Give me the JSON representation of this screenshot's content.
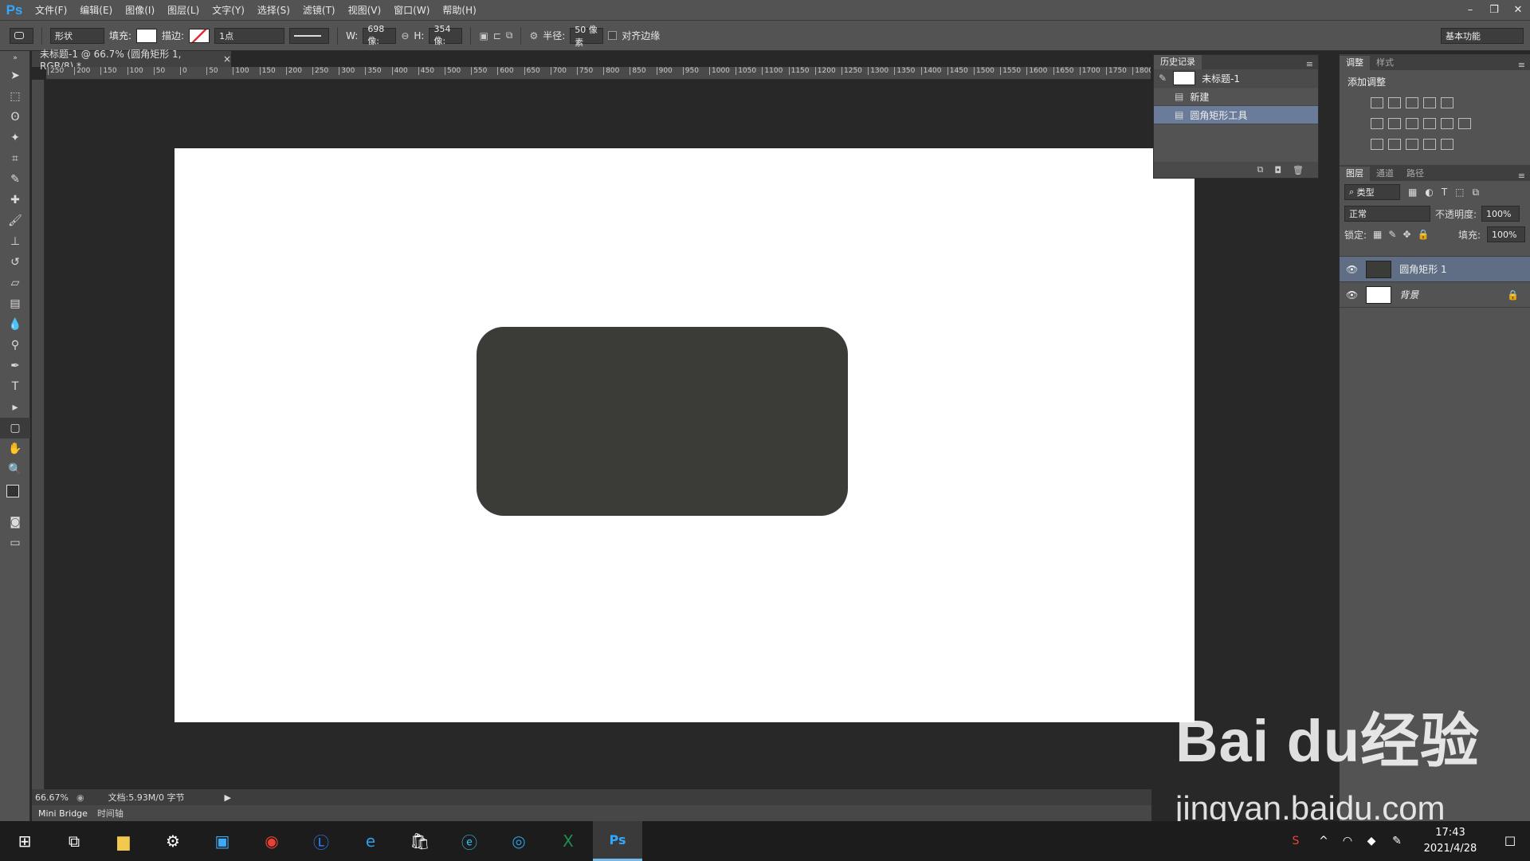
{
  "app": {
    "logo": "Ps"
  },
  "menu": [
    "文件(F)",
    "编辑(E)",
    "图像(I)",
    "图层(L)",
    "文字(Y)",
    "选择(S)",
    "滤镜(T)",
    "视图(V)",
    "窗口(W)",
    "帮助(H)"
  ],
  "window_controls": [
    "minimize",
    "restore",
    "close"
  ],
  "options": {
    "mode": "形状",
    "fill_label": "填充:",
    "stroke_label": "描边:",
    "stroke_width": "1点",
    "w_label": "W:",
    "w_value": "698 像:",
    "h_label": "H:",
    "h_value": "354 像:",
    "radius_label": "半径:",
    "radius_value": "50 像素",
    "align_edges_label": "对齐边缘",
    "workspace": "基本功能"
  },
  "document": {
    "tab_title": "未标题-1 @ 66.7% (圆角矩形 1, RGB/8) *",
    "ruler_h": [
      "250",
      "200",
      "150",
      "100",
      "50",
      "0",
      "50",
      "100",
      "150",
      "200",
      "250",
      "300",
      "350",
      "400",
      "450",
      "500",
      "550",
      "600",
      "650",
      "700",
      "750",
      "800",
      "850",
      "900",
      "950",
      "1000",
      "1050",
      "1100",
      "1150",
      "1200",
      "1250",
      "1300",
      "1350",
      "1400",
      "1450",
      "1500",
      "1550",
      "1600",
      "1650",
      "1700",
      "1750",
      "1800"
    ],
    "shape_color": "#3b3c37"
  },
  "status": {
    "zoom": "66.67%",
    "doc_info": "文档:5.93M/0 字节"
  },
  "bottom_tabs": [
    "Mini Bridge",
    "时间轴"
  ],
  "history": {
    "tab": "历史记录",
    "snapshot": "未标题-1",
    "items": [
      "新建",
      "圆角矩形工具"
    ]
  },
  "adjust": {
    "tabs": [
      "调整",
      "样式"
    ],
    "title": "添加调整"
  },
  "layers": {
    "tabs": [
      "图层",
      "通道",
      "路径"
    ],
    "filter": "类型",
    "blend": "正常",
    "opacity_label": "不透明度:",
    "opacity": "100%",
    "lock_label": "锁定:",
    "fill_label": "填充:",
    "fill": "100%",
    "items": [
      "圆角矩形 1",
      "背景"
    ]
  },
  "taskbar": {
    "time": "17:43",
    "date": "2021/4/28"
  },
  "watermark": {
    "main": "Bai du经验",
    "sub": "jingyan.baidu.com"
  }
}
